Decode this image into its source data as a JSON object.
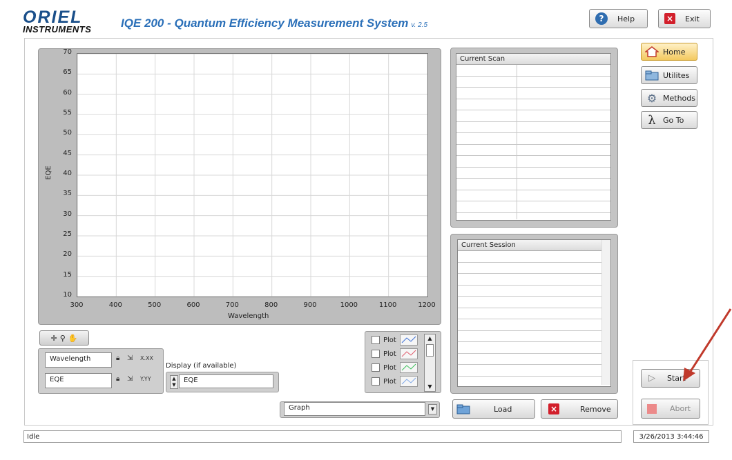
{
  "header": {
    "logo_top": "ORIEL",
    "logo_bottom": "INSTRUMENTS",
    "title": "IQE 200 - Quantum Efficiency Measurement System",
    "version": "v. 2.5",
    "help_label": "Help",
    "exit_label": "Exit"
  },
  "graph": {
    "y_axis_title": "EQE",
    "x_axis_title": "Wavelength",
    "y_ticks": [
      "70",
      "65",
      "60",
      "55",
      "50",
      "45",
      "40",
      "35",
      "30",
      "25",
      "20",
      "15",
      "10"
    ],
    "x_ticks": [
      "300",
      "400",
      "500",
      "600",
      "700",
      "800",
      "900",
      "1000",
      "1100",
      "1200"
    ],
    "chart_data": {
      "type": "line",
      "series": [],
      "xlabel": "Wavelength",
      "ylabel": "EQE",
      "xlim": [
        300,
        1200
      ],
      "ylim": [
        10,
        70
      ],
      "grid": true
    }
  },
  "legend": {
    "x_name": "Wavelength",
    "y_name": "EQE",
    "x_format": "X.XX",
    "y_format": "Y.YY"
  },
  "display": {
    "label": "Display (if available)",
    "value": "EQE"
  },
  "plots": [
    "Plot",
    "Plot",
    "Plot",
    "Plot"
  ],
  "graph_select": "Graph",
  "current_scan": {
    "title": "Current Scan"
  },
  "current_session": {
    "title": "Current Session"
  },
  "actions": {
    "load": "Load",
    "remove": "Remove"
  },
  "nav": {
    "home": "Home",
    "utilities": "Utilites",
    "methods": "Methods",
    "goto": "Go To"
  },
  "run": {
    "start": "Start",
    "abort": "Abort"
  },
  "status": {
    "text": "Idle",
    "datetime": "3/26/2013 3:44:46"
  },
  "colors": {
    "accent": "#2a6fb8",
    "home_button": "#f3c95f",
    "abort_red": "#e88080"
  }
}
